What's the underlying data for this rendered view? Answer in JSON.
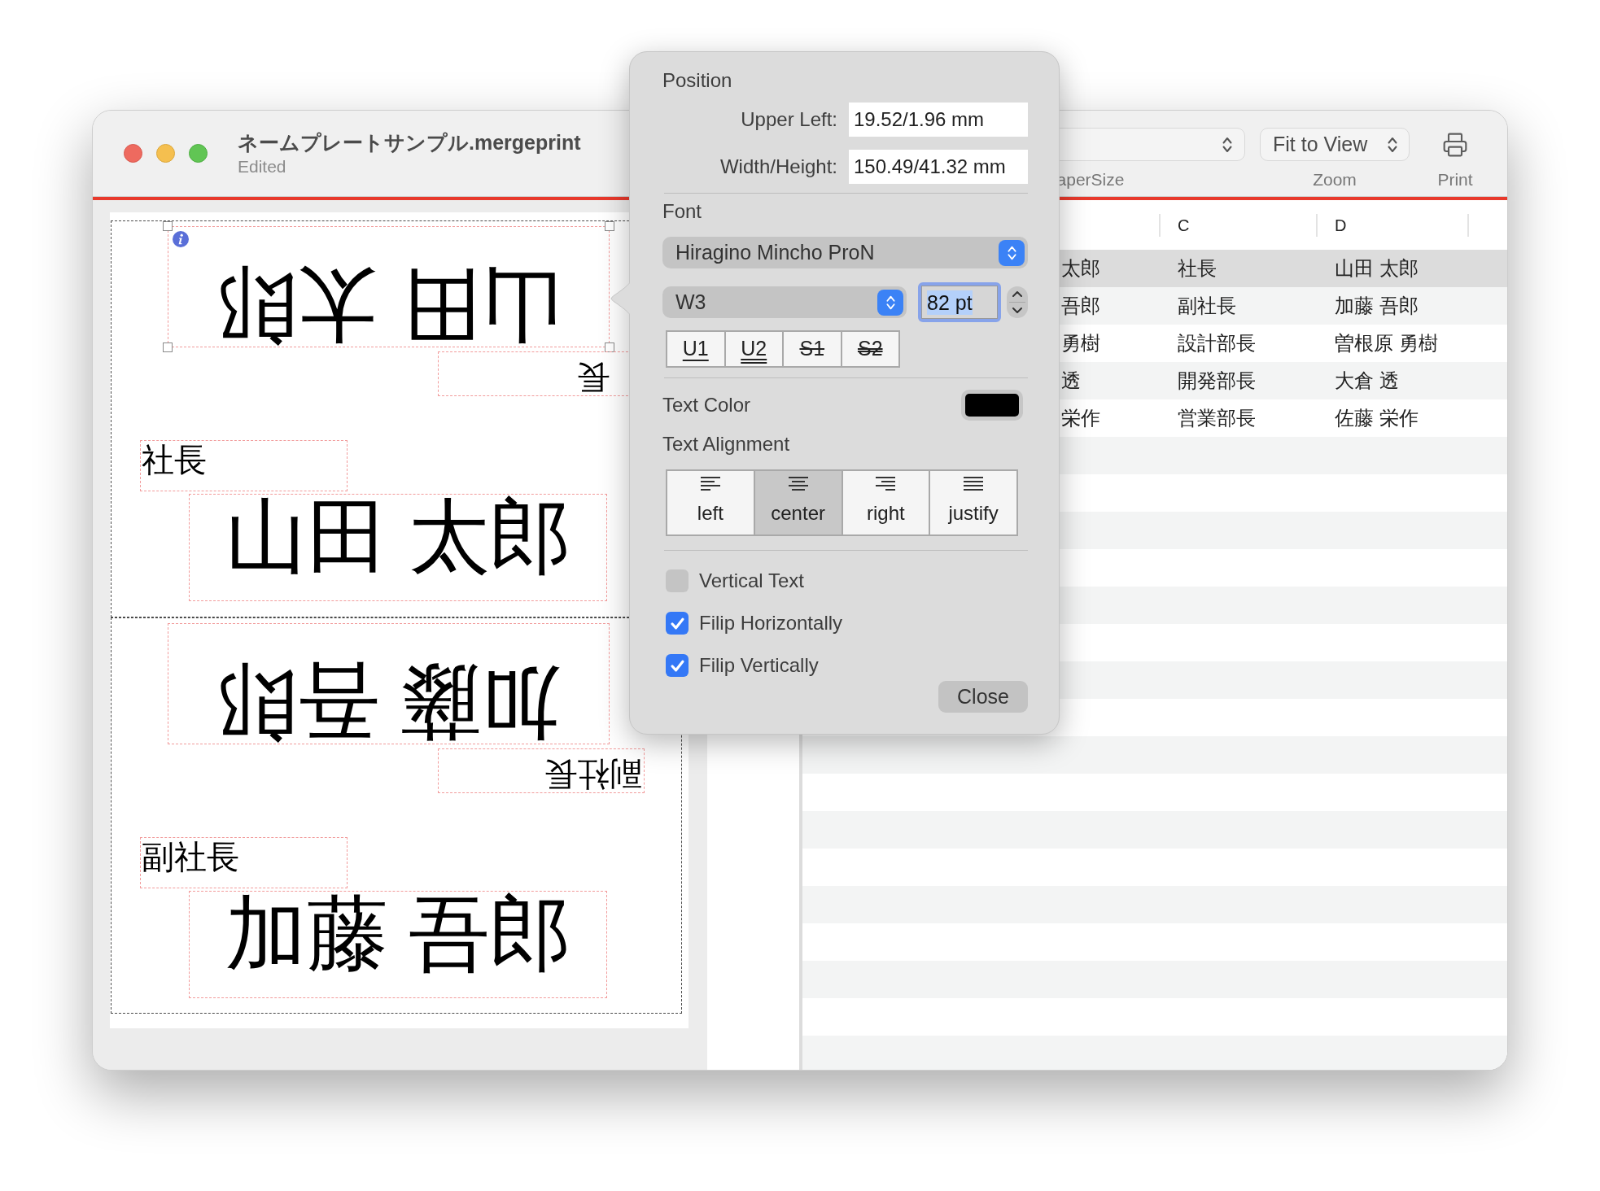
{
  "window": {
    "title": "ネームプレートサンプル.mergeprint",
    "subtitle": "Edited"
  },
  "toolbar": {
    "paper_size": {
      "label": "aperSize"
    },
    "zoom": {
      "value": "Fit to View",
      "label": "Zoom"
    },
    "print": {
      "label": "Print"
    }
  },
  "canvas": {
    "plates": [
      {
        "fields": [
          {
            "kind": "name",
            "text": "山田 太郎",
            "flipped": true,
            "selected": true
          },
          {
            "kind": "title",
            "text": "長",
            "flipped": true,
            "selected": false
          },
          {
            "kind": "title",
            "text": "社長",
            "flipped": false,
            "selected": false
          },
          {
            "kind": "name",
            "text": "山田 太郎",
            "flipped": false,
            "selected": false
          }
        ]
      },
      {
        "fields": [
          {
            "kind": "name",
            "text": "加藤 吾郎",
            "flipped": true,
            "selected": false
          },
          {
            "kind": "title",
            "text": "副社長",
            "flipped": true,
            "selected": false
          },
          {
            "kind": "title",
            "text": "副社長",
            "flipped": false,
            "selected": false
          },
          {
            "kind": "name",
            "text": "加藤 吾郎",
            "flipped": false,
            "selected": false
          }
        ]
      }
    ]
  },
  "table": {
    "columns": [
      "",
      "C",
      "D"
    ],
    "rows": [
      {
        "cells": [
          "太郎",
          "社長",
          "山田 太郎"
        ],
        "selected": true
      },
      {
        "cells": [
          "吾郎",
          "副社長",
          "加藤 吾郎"
        ],
        "selected": false
      },
      {
        "cells": [
          "勇樹",
          "設計部長",
          "曽根原 勇樹"
        ],
        "selected": false
      },
      {
        "cells": [
          "透",
          "開発部長",
          "大倉 透"
        ],
        "selected": false
      },
      {
        "cells": [
          "栄作",
          "営業部長",
          "佐藤 栄作"
        ],
        "selected": false
      }
    ]
  },
  "inspector": {
    "position": {
      "heading": "Position",
      "fields": [
        {
          "label": "Upper Left:",
          "value": "19.52/1.96 mm"
        },
        {
          "label": "Width/Height:",
          "value": "150.49/41.32 mm"
        }
      ]
    },
    "font": {
      "heading": "Font",
      "family": "Hiragino Mincho ProN",
      "weight": "W3",
      "size": {
        "value": "82 pt",
        "focused": true
      },
      "styles": [
        {
          "label": "U1",
          "kind": "underline",
          "selected": false
        },
        {
          "label": "U2",
          "kind": "double-underline",
          "selected": false
        },
        {
          "label": "S1",
          "kind": "strike",
          "selected": false
        },
        {
          "label": "S2",
          "kind": "double-strike",
          "selected": false
        }
      ]
    },
    "text_color": {
      "label": "Text Color",
      "color": "#000000"
    },
    "alignment": {
      "label": "Text Alignment",
      "options": [
        {
          "label": "left",
          "kind": "left",
          "selected": false
        },
        {
          "label": "center",
          "kind": "center",
          "selected": true
        },
        {
          "label": "right",
          "kind": "right",
          "selected": false
        },
        {
          "label": "justify",
          "kind": "justify",
          "selected": false
        }
      ]
    },
    "options": [
      {
        "label": "Vertical Text",
        "checked": false
      },
      {
        "label": "Filip Horizontally",
        "checked": true
      },
      {
        "label": "Filip Vertically",
        "checked": true
      }
    ],
    "close": "Close"
  }
}
